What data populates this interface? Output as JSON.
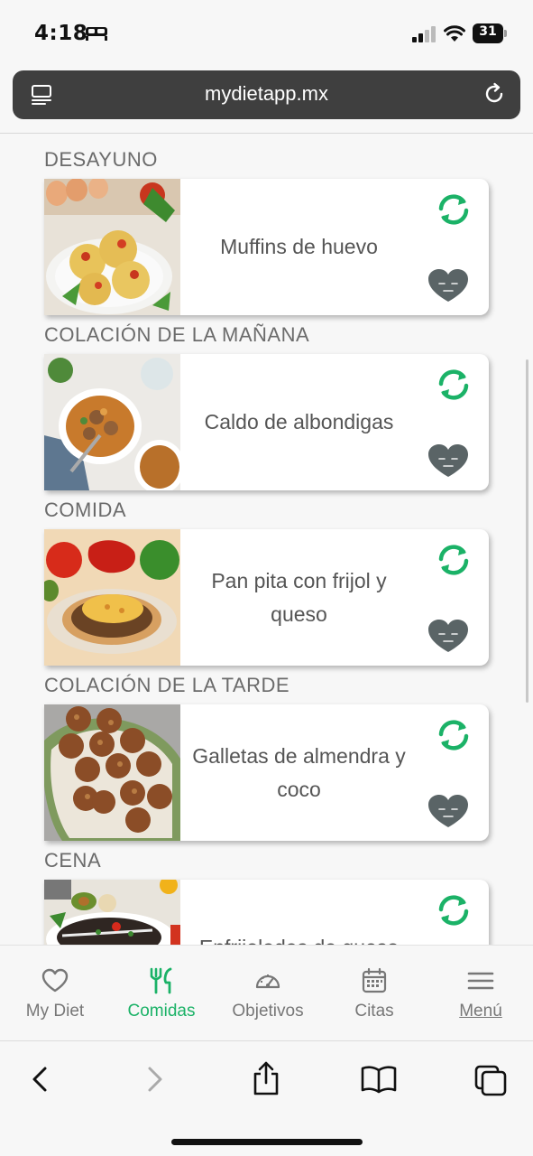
{
  "status_bar": {
    "time": "4:18",
    "battery": "31"
  },
  "browser": {
    "url": "mydietapp.mx"
  },
  "meals": [
    {
      "section": "DESAYUNO",
      "name": "Muffins de huevo",
      "photo": "egg-muffins-photo"
    },
    {
      "section": "COLACIÓN DE LA MAÑANA",
      "name": "Caldo de albondigas",
      "photo": "meatball-soup-photo"
    },
    {
      "section": "COMIDA",
      "name": "Pan pita con frijol y queso",
      "photo": "pita-bean-cheese-photo"
    },
    {
      "section": "COLACIÓN DE LA TARDE",
      "name": "Galletas de almendra y coco",
      "photo": "almond-coconut-cookies-photo"
    },
    {
      "section": "CENA",
      "name": "Enfrijoladas de queso",
      "photo": "enfrijoladas-photo"
    }
  ],
  "nav": {
    "items": [
      {
        "label": "My Diet",
        "icon": "heart-outline-icon"
      },
      {
        "label": "Comidas",
        "icon": "fork-knife-icon",
        "active": true
      },
      {
        "label": "Objetivos",
        "icon": "gauge-icon"
      },
      {
        "label": "Citas",
        "icon": "calendar-icon"
      },
      {
        "label": "Menú",
        "icon": "hamburger-icon"
      }
    ]
  },
  "colors": {
    "accent": "#1bb267",
    "heart": "#5a6466",
    "url_bar": "#3f3f3f"
  }
}
